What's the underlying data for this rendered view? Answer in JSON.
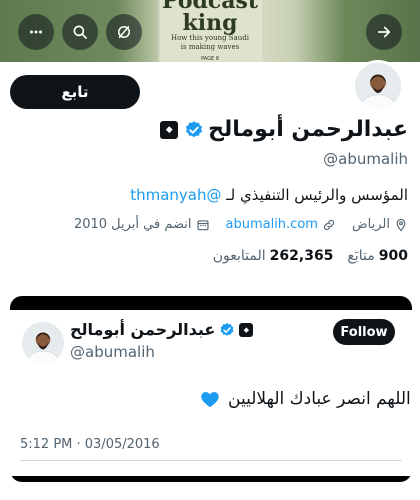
{
  "banner": {
    "magazine_title": "Podcast\nking",
    "magazine_subtitle": "How this young Saudi\nis making waves",
    "magazine_page": "PAGE 8",
    "buttons": [
      "more-icon",
      "search-icon",
      "mute-icon",
      "next-icon"
    ]
  },
  "profile": {
    "follow_label": "تابع",
    "display_name": "عبدالرحمن أبومالح",
    "handle": "@abumalih",
    "bio_text": "المؤسس والرئيس التنفيذي لـ ",
    "bio_mention": "@thmanyah",
    "location": "الرياض",
    "website": "abumalih.com",
    "joined": "انضم في أبريل 2010",
    "following_count": "900",
    "following_label": "متابَع",
    "followers_count": "262,365",
    "followers_label": "المتابعون",
    "colors": {
      "accent": "#1d9bf0",
      "verified": "#1d9bf0",
      "text": "#0f1419",
      "muted": "#536471"
    }
  },
  "tweet": {
    "display_name": "عبدالرحمن أبومالح",
    "handle": "@abumalih",
    "follow_label": "Follow",
    "text": "اللهم انصر عبادك الهلاليين",
    "heart_color": "#1d9bf0",
    "timestamp": "5:12 PM · 03/05/2016"
  }
}
